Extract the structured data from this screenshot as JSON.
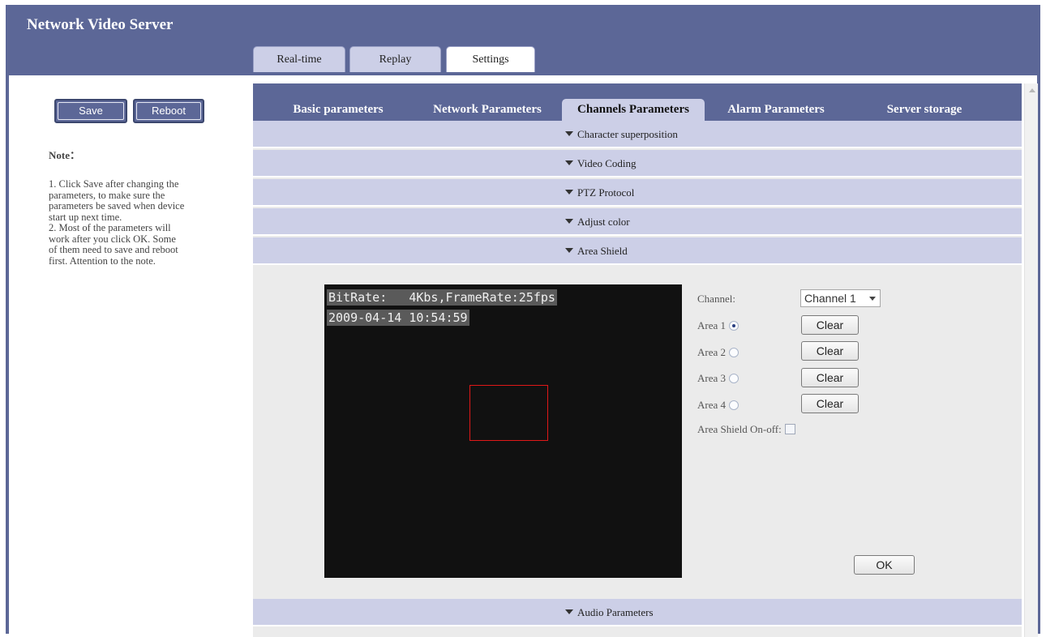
{
  "app": {
    "title": "Network Video Server"
  },
  "top_tabs": [
    {
      "label": "Real-time",
      "active": false
    },
    {
      "label": "Replay",
      "active": false
    },
    {
      "label": "Settings",
      "active": true
    }
  ],
  "left_panel": {
    "save_label": "Save",
    "reboot_label": "Reboot",
    "note_title": "Note：",
    "note_lines": [
      "1. Click Save after changing the",
      "parameters, to make sure the",
      "parameters be saved when device",
      "start up next time.",
      "2. Most of the parameters will",
      "work after you click OK. Some",
      "of them need to save and reboot",
      "first. Attention to the note."
    ]
  },
  "param_tabs": [
    {
      "label": "Basic parameters",
      "active": false
    },
    {
      "label": "Network Parameters",
      "active": false
    },
    {
      "label": "Channels Parameters",
      "active": true
    },
    {
      "label": "Alarm Parameters",
      "active": false
    },
    {
      "label": "Server storage",
      "active": false
    }
  ],
  "sections": {
    "character": "Character superposition",
    "video_coding": "Video Coding",
    "ptz": "PTZ Protocol",
    "adjust_color": "Adjust color",
    "area_shield": "Area Shield",
    "audio": "Audio Parameters"
  },
  "area_shield": {
    "osd_line1": "BitRate:   4Kbs,FrameRate:25fps",
    "osd_line2": "2009-04-14 10:54:59",
    "channel_label": "Channel:",
    "channel_value": "Channel 1",
    "areas": [
      {
        "label": "Area 1",
        "selected": true
      },
      {
        "label": "Area 2",
        "selected": false
      },
      {
        "label": "Area 3",
        "selected": false
      },
      {
        "label": "Area 4",
        "selected": false
      }
    ],
    "clear_label": "Clear",
    "onoff_label": "Area Shield On-off:",
    "onoff_checked": false,
    "ok_label": "OK",
    "shield_color": "#e01818"
  },
  "colors": {
    "header": "#5c6797",
    "tab_inactive": "#cccfe7",
    "content_bg": "#ebebeb"
  }
}
